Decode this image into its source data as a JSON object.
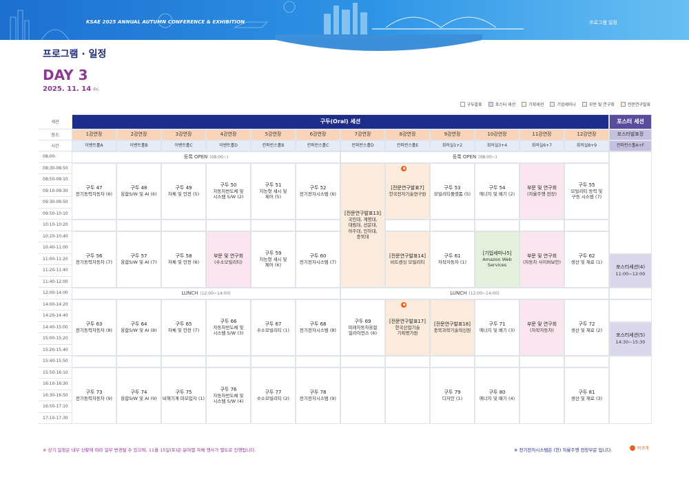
{
  "banner": {
    "conference": "KSAE 2025 ANNUAL AUTUMN CONFERENCE & EXHIBITION",
    "crumb": "프로그램 일정"
  },
  "page_title": "프로그램 · 일정",
  "day": "DAY 3",
  "date": "2025. 11. 14",
  "weekday": "Fri.",
  "legend": [
    "구두발표",
    "포스터 세션",
    "기획세션",
    "기업세미나",
    "부문 및 연구회",
    "전문연구발표"
  ],
  "labels": {
    "session": "세션",
    "place": "장소",
    "time": "시간"
  },
  "header": {
    "oral": "구두(Oral) 세션",
    "poster": "포스터 세션"
  },
  "halls": [
    "1강연장",
    "2강연장",
    "3강연장",
    "4강연장",
    "5강연장",
    "6강연장",
    "7강연장",
    "8강연장",
    "9강연장",
    "10강연장",
    "11강연장",
    "12강연장"
  ],
  "poster_hall": "포스터발표장",
  "rooms": [
    "이벤트홀A",
    "이벤트홀B",
    "이벤트홀C",
    "이벤트홀D",
    "컨퍼런스홀B",
    "컨퍼런스홀C",
    "컨퍼런스홀D",
    "컨퍼런스홀E",
    "회의실1+2",
    "회의실3+4",
    "회의실6+7",
    "회의실8+9"
  ],
  "poster_room": "컨퍼런스홀A+F",
  "times": [
    "08:00-",
    "08:30-08:50",
    "08:50-09:10",
    "09:10-09:30",
    "09:30-09:50",
    "09:50-10:10",
    "10:10-10:20",
    "10:20-10:40",
    "10:40-11:00",
    "11:00-11:20",
    "11:20-11:40",
    "11:40-12:00",
    "12:00-14:00",
    "14:00-14:20",
    "14:20-14:40",
    "14:40-15:00",
    "15:00-15:20",
    "15:20-15:40",
    "15:40-15:50",
    "15:50-16:10",
    "16:10-16:30",
    "16:30-16:50",
    "16:50-17:10",
    "17:10-17:30"
  ],
  "bands": {
    "reg": "등록 OPEN",
    "reg_t": "(08:00~)",
    "lunch": "LUNCH",
    "lunch_t": "(12:00~14:00)"
  },
  "block1": [
    {
      "t": "구두 47",
      "s": "전기동력자동차 (6)"
    },
    {
      "t": "구두 48",
      "s": "융합S/W 및 AI (6)"
    },
    {
      "t": "구두 49",
      "s": "차체 및 안전 (5)"
    },
    {
      "t": "구두 50",
      "s": "자동차반도체 및\n시스템 S/W (2)"
    },
    {
      "t": "구두 51",
      "s": "지능형 섀시 및\n제어 (5)"
    },
    {
      "t": "구두 52",
      "s": "전기전자시스템 (6)"
    },
    {
      "t": "[전문연구발표13]",
      "s": "국민대, 계명대,\n대림대, 선문대,\n아주대, 인하대,\n충북대"
    },
    {
      "t": "[전문연구발표7]",
      "s": "한국전자기술연구원"
    },
    {
      "t": "구두 53",
      "s": "모빌리티플랫폼 (5)"
    },
    {
      "t": "구두 54",
      "s": "에너지 및 배기 (2)"
    },
    {
      "t": "부문 및 연구회",
      "s": "(자율주행 전장)"
    },
    {
      "t": "구두 55",
      "s": "모빌리티 동력 및\n구동 시스템 (7)"
    }
  ],
  "block2": [
    {
      "t": "구두 56",
      "s": "전기동력자동차 (7)"
    },
    {
      "t": "구두 57",
      "s": "융합S/W 및 AI (7)"
    },
    {
      "t": "구두 58",
      "s": "차체 및 안전 (6)"
    },
    {
      "t": "부문 및 연구회",
      "s": "(수소모빌리티)"
    },
    {
      "t": "구두 59",
      "s": "지능형 섀시 및\n제어 (6)"
    },
    {
      "t": "구두 60",
      "s": "전기전자시스템 (7)"
    },
    {
      "t": "[전문연구발표14]",
      "s": "비트센싱 모빌리티"
    },
    {
      "t": "구두 61",
      "s": "자작자동차 (1)"
    },
    {
      "t": "[기업세미나5]",
      "s": "Amazon Web\nServices"
    },
    {
      "t": "부문 및 연구회",
      "s": "(자동차 사이버보안)"
    },
    {
      "t": "구두 62",
      "s": "생산 및 재료 (1)"
    }
  ],
  "poster1": {
    "t": "포스터세션(4)",
    "s": "11:00~12:00"
  },
  "block3": [
    {
      "t": "구두 63",
      "s": "전기동력자동차 (8)"
    },
    {
      "t": "구두 64",
      "s": "융합S/W 및 AI (8)"
    },
    {
      "t": "구두 65",
      "s": "차체 및 안전 (7)"
    },
    {
      "t": "구두 66",
      "s": "자동차반도체 및\n시스템 S/W (3)"
    },
    {
      "t": "구두 67",
      "s": "수소모빌리티 (1)"
    },
    {
      "t": "구두 68",
      "s": "전기전자시스템 (8)"
    },
    {
      "t": "구두 69",
      "s": "미래자동차융합\n얼라이언스 (6)"
    },
    {
      "t": "[전문연구발표17]",
      "s": "한국산업기술\n기획평가원"
    },
    {
      "t": "[전문연구발표18]",
      "s": "충북과학기술혁신원"
    },
    {
      "t": "구두 71",
      "s": "에너지 및 배기 (3)"
    },
    {
      "t": "부문 및 연구회",
      "s": "(자작자동차)"
    },
    {
      "t": "구두 72",
      "s": "생산 및 재료 (2)"
    }
  ],
  "poster2": {
    "t": "포스터세션(5)",
    "s": "14:30~15:30"
  },
  "block4": [
    {
      "t": "구두 73",
      "s": "전기동력자동차 (9)"
    },
    {
      "t": "구두 74",
      "s": "융합S/W 및 AI (9)"
    },
    {
      "t": "구두 75",
      "s": "비해기계 마모입자 (1)"
    },
    {
      "t": "구두 76",
      "s": "자동차반도체 및\n시스템 S/W (4)"
    },
    {
      "t": "구두 77",
      "s": "수소모빌리티 (2)"
    },
    {
      "t": "구두 78",
      "s": "전기전자시스템 (9)"
    },
    {
      "t": "",
      "s": ""
    },
    {
      "t": "",
      "s": ""
    },
    {
      "t": "구두 79",
      "s": "디자인 (1)"
    },
    {
      "t": "구두 80",
      "s": "에너지 및 배기 (4)"
    },
    {
      "t": "",
      "s": ""
    },
    {
      "t": "구두 81",
      "s": "생산 및 재료 (3)"
    }
  ],
  "footnote_left": "※ 상기 일정은 내부 상황에 따라 일부 변경될 수 있으며, 11월 15일(토)은 분야별 자체 행사가 별도로 진행됩니다.",
  "footnote_right": "※ 전기전자시스템은 (현) 자율주행 전장부문 입니다.",
  "private_label": "비공개",
  "colors": {
    "oral_header": "#1f2d8a",
    "poster_header": "#5a4c9c",
    "hall": "#f9d4b8",
    "expert": "#fbebdc",
    "dept": "#fbe6ef",
    "industry": "#e4f0dc",
    "poster": "#dad7ec",
    "accent": "#8b3a8f"
  }
}
